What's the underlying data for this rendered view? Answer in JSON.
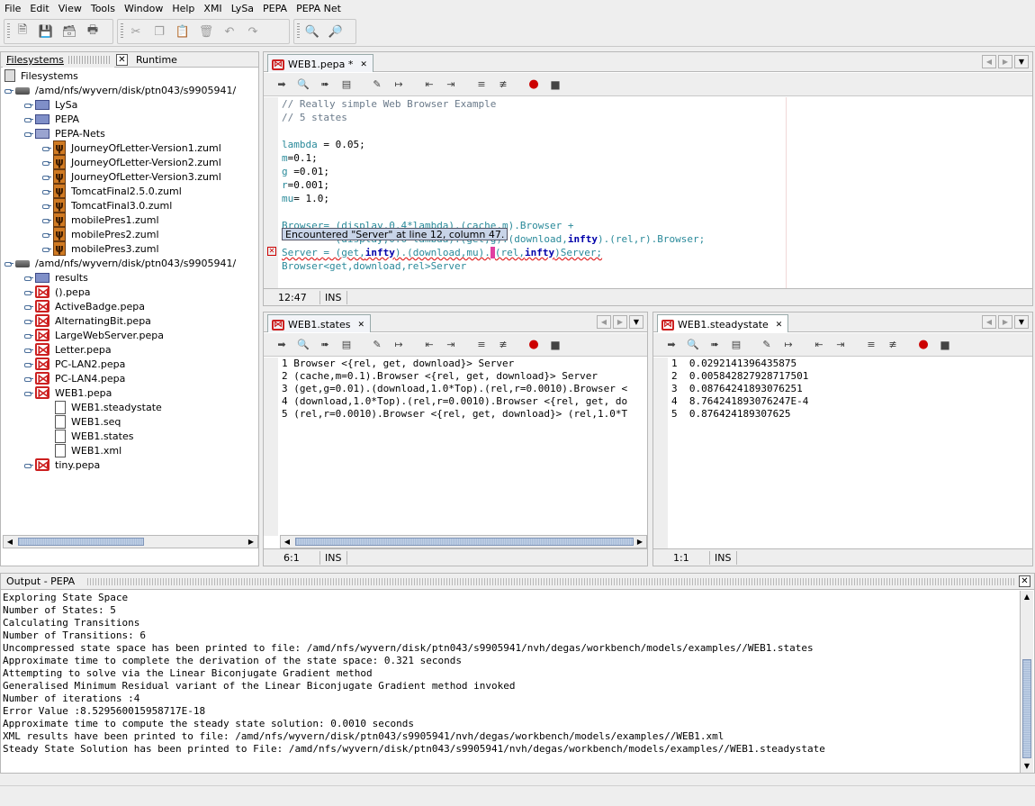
{
  "menu": [
    "File",
    "Edit",
    "View",
    "Tools",
    "Window",
    "Help",
    "XMI",
    "LySa",
    "PEPA",
    "PEPA Net"
  ],
  "explorer": {
    "tabs": [
      "Filesystems",
      "Runtime"
    ],
    "root": "Filesystems",
    "mount1": "/amd/nfs/wyvern/disk/ptn043/s9905941/",
    "mount1_children": [
      "LySa",
      "PEPA",
      "PEPA-Nets"
    ],
    "pepanets_children": [
      "JourneyOfLetter-Version1.zuml",
      "JourneyOfLetter-Version2.zuml",
      "JourneyOfLetter-Version3.zuml",
      "TomcatFinal2.5.0.zuml",
      "TomcatFinal3.0.zuml",
      "mobilePres1.zuml",
      "mobilePres2.zuml",
      "mobilePres3.zuml"
    ],
    "mount2": "/amd/nfs/wyvern/disk/ptn043/s9905941/",
    "mount2_children": [
      "results",
      "().pepa",
      "ActiveBadge.pepa",
      "AlternatingBit.pepa",
      "LargeWebServer.pepa",
      "Letter.pepa",
      "PC-LAN2.pepa",
      "PC-LAN4.pepa",
      "WEB1.pepa"
    ],
    "web1_children": [
      "WEB1.steadystate",
      "WEB1.seq",
      "WEB1.states",
      "WEB1.xml"
    ],
    "tiny": "tiny.pepa"
  },
  "editor": {
    "tab": "WEB1.pepa *",
    "lines": {
      "l1": "// Really simple Web Browser Example",
      "l2": "// 5 states",
      "l4a": "lambda",
      "l4b": " = 0.05;",
      "l5a": "m",
      "l5b": "=0.1;",
      "l6a": "g",
      "l6b": " =0.01;",
      "l7a": "r",
      "l7b": "=0.001;",
      "l8a": "mu",
      "l8b": "= 1.0;",
      "l10a": "Browser",
      "l10b": "= (display,0.4*lambda).(cache,m).Browser +",
      "l11a": "         (display,0.6*lambda).(get,g).(download,",
      "l11b": "infty",
      "l11c": ").(rel,r).Browser;",
      "l12a": "Server",
      "l12b": " = (get,",
      "l12c": "infty",
      "l12d": ").(download,mu).",
      "l12e": "(rel,",
      "l12f": "infty",
      "l12g": ")Server;",
      "l13": "Browser<get,download,rel>Server"
    },
    "tooltip": "Encountered \"Server\" at line 12, column 47.",
    "status_pos": "12:47",
    "status_mode": "INS"
  },
  "states": {
    "tab": "WEB1.states",
    "lines": [
      "1 Browser <{rel, get, download}> Server",
      "2 (cache,m=0.1).Browser <{rel, get, download}> Server",
      "3 (get,g=0.01).(download,1.0*Top).(rel,r=0.0010).Browser <",
      "4 (download,1.0*Top).(rel,r=0.0010).Browser <{rel, get, do",
      "5 (rel,r=0.0010).Browser <{rel, get, download}> (rel,1.0*T"
    ],
    "status_pos": "6:1",
    "status_mode": "INS"
  },
  "steady": {
    "tab": "WEB1.steadystate",
    "lines": [
      "1  0.0292141396435875",
      "2  0.005842827928717501",
      "3  0.08764241893076251",
      "4  8.764241893076247E-4",
      "5  0.876424189307625"
    ],
    "status_pos": "1:1",
    "status_mode": "INS"
  },
  "output": {
    "title": "Output - PEPA",
    "lines": [
      "Exploring State Space",
      "Number of States: 5",
      "Calculating Transitions",
      "Number of Transitions: 6",
      "Uncompressed state space has been printed to file: /amd/nfs/wyvern/disk/ptn043/s9905941/nvh/degas/workbench/models/examples//WEB1.states",
      "Approximate time to complete the derivation of the state space: 0.321 seconds",
      "Attempting to solve via the Linear Biconjugate Gradient method",
      "Generalised Minimum Residual variant of the Linear Biconjugate Gradient method invoked",
      "Number of iterations :4",
      "Error Value :8.529560015958717E-18",
      "Approximate time to compute the steady state solution: 0.0010 seconds",
      "XML results have been printed to file: /amd/nfs/wyvern/disk/ptn043/s9905941/nvh/degas/workbench/models/examples//WEB1.xml",
      "Steady State Solution has been printed to File: /amd/nfs/wyvern/disk/ptn043/s9905941/nvh/degas/workbench/models/examples//WEB1.steadystate"
    ]
  }
}
